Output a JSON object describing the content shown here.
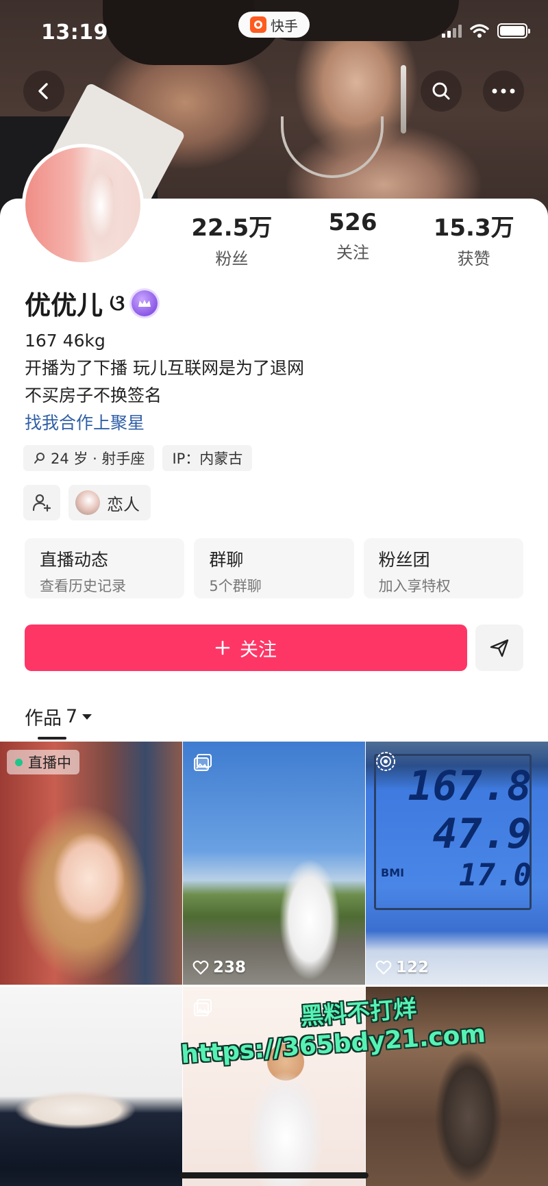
{
  "status_bar": {
    "time": "13:19",
    "app_name": "快手"
  },
  "header": {
    "back_icon": "chevron-left-icon",
    "search_icon": "search-icon",
    "more_icon": "more-dots-icon"
  },
  "profile": {
    "name": "优优儿",
    "name_emoji": "ଓ",
    "stats": [
      {
        "value": "22.5万",
        "label": "粉丝"
      },
      {
        "value": "526",
        "label": "关注"
      },
      {
        "value": "15.3万",
        "label": "获赞"
      }
    ],
    "bio_lines": [
      "167 46kg",
      "开播为了下播 玩儿互联网是为了退网",
      "不买房子不换签名"
    ],
    "bio_link": "找我合作上聚星",
    "tags": [
      {
        "icon": "person-search-icon",
        "text": "24 岁 · 射手座"
      },
      {
        "text": "IP：内蒙古"
      }
    ],
    "relation_label": "恋人"
  },
  "cards": [
    {
      "title": "直播动态",
      "subtitle": "查看历史记录"
    },
    {
      "title": "群聊",
      "subtitle": "5个群聊"
    },
    {
      "title": "粉丝团",
      "subtitle": "加入享特权"
    }
  ],
  "actions": {
    "follow_label": "关注"
  },
  "works": {
    "tab_label": "作品",
    "count": "7"
  },
  "grid": {
    "live_badge": "直播中",
    "tiles": [
      {
        "likes": ""
      },
      {
        "likes": "238"
      },
      {
        "likes": "122",
        "scale_readings": [
          "167.8",
          "47.9",
          "17.0"
        ],
        "scale_label": "BMI"
      },
      {
        "likes": ""
      },
      {
        "likes": ""
      },
      {
        "likes": ""
      }
    ]
  },
  "watermark": {
    "line1": "黑料不打烊",
    "line2": "https://365bdy21.com"
  },
  "colors": {
    "follow_button": "#fe3666",
    "link": "#2f5fa7",
    "live_dot": "#20c58c",
    "watermark": "#56f2b4"
  }
}
